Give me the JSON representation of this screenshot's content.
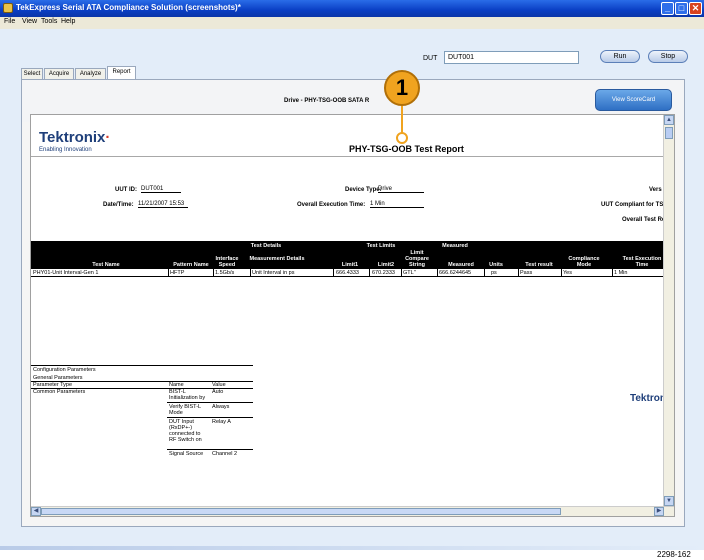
{
  "window": {
    "title": "TekExpress Serial ATA Compliance Solution (screenshots)*"
  },
  "menu": [
    "File",
    "View",
    "Tools",
    "Help"
  ],
  "toolbar": {
    "dut_label": "DUT",
    "dut_value": "DUT001",
    "run_label": "Run",
    "stop_label": "Stop"
  },
  "tabs": [
    "Select",
    "Acquire",
    "Analyze",
    "Report"
  ],
  "active_tab": "Report",
  "panel": {
    "drive_label": "Drive - PHY-TSG-OOB SATA R",
    "scorecard_label": "View ScoreCard"
  },
  "report": {
    "logo": "Tektronix",
    "tagline": "Enabling Innovation",
    "title": "PHY-TSG-OOB Test Report",
    "fields": {
      "uut_id_label": "UUT ID:",
      "uut_id_value": "DUT001",
      "device_type_label": "Device Type:",
      "device_type_value": "Drive",
      "version_label": "Vers",
      "date_label": "Date/Time:",
      "date_value": "11/21/2007 15:53",
      "exec_time_label": "Overall Execution Time:",
      "exec_time_value": "1 Min",
      "compliant_label": "UUT Compliant for TSG T",
      "overall_result_label": "Overall Test Res"
    },
    "table": {
      "group_headers": [
        "Test Details",
        "Test Limits",
        "Measured"
      ],
      "columns": [
        "Test Name",
        "Pattern Name",
        "Interface Speed",
        "Measurement Details",
        "Limit1",
        "Limit2",
        "Limit Compare String",
        "Measured",
        "Units",
        "Test result",
        "Compliance Mode",
        "Test Execution Time"
      ],
      "rows": [
        [
          "PHY01-Unit Interval-Gen 1",
          "HFTP",
          "1.5Gb/s",
          "Unit Interval in ps",
          "666.4333",
          "670.2333",
          "GTL\"",
          "666.6244645",
          "ps",
          "Pass",
          "Yes",
          "1 Min"
        ]
      ]
    },
    "config": {
      "title": "Configuration Parameters",
      "subtitle": "General Parameters",
      "headers": [
        "Parameter Type",
        "Name",
        "Value"
      ],
      "group": "Common Parameters",
      "rows": [
        [
          "BIST-L Initialization by",
          "Auto"
        ],
        [
          "Verify BIST-L Mode",
          "Always"
        ],
        [
          "DUT Input (RxDP+-) connected to RF Switch on",
          "Relay A"
        ],
        [
          "Signal Source",
          "Channel 2"
        ]
      ]
    },
    "logo_small": "Tektronix"
  },
  "callout": {
    "number": "1"
  },
  "figure_number": "2298-162",
  "colors": {
    "titlebar": "#0a3fc4",
    "callout": "#f0a31f",
    "logo": "#1f3f7a",
    "workarea": "#e3edf9"
  }
}
